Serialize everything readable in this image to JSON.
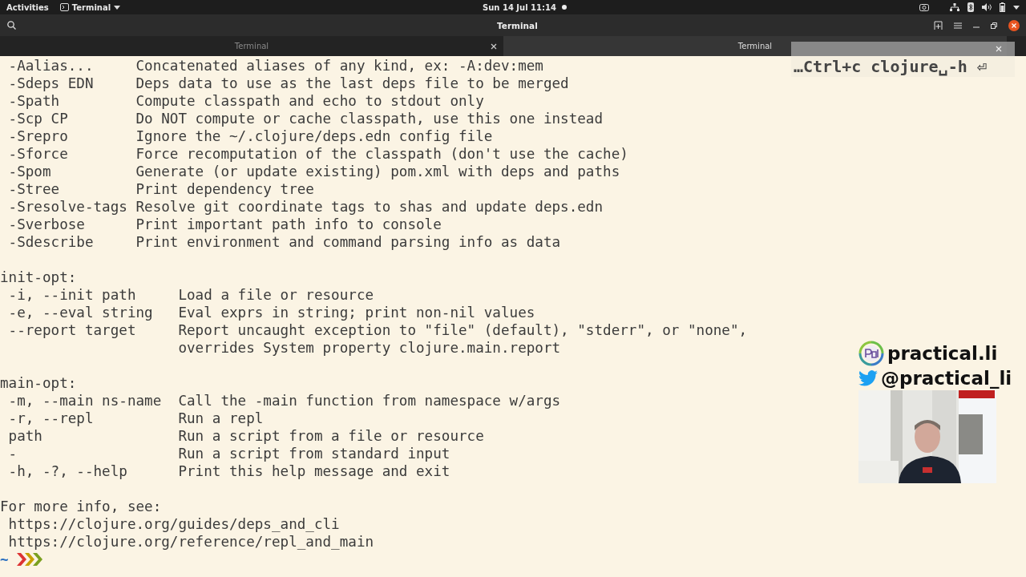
{
  "top_bar": {
    "activities": "Activities",
    "app_menu": "Terminal",
    "clock": "Sun 14 Jul  11:14"
  },
  "window": {
    "title": "Terminal"
  },
  "tabs": [
    {
      "label": "Terminal",
      "selected": false
    },
    {
      "label": "Terminal",
      "selected": true
    }
  ],
  "keystroke_overlay": {
    "text": "…Ctrl+c clojure␣-h ⏎"
  },
  "terminal_lines": [
    {
      "kind": "text",
      "text": " -Aalias...     Concatenated aliases of any kind, ex: -A:dev:mem"
    },
    {
      "kind": "text",
      "text": " -Sdeps EDN     Deps data to use as the last deps file to be merged"
    },
    {
      "kind": "text",
      "text": " -Spath         Compute classpath and echo to stdout only"
    },
    {
      "kind": "text",
      "text": " -Scp CP        Do NOT compute or cache classpath, use this one instead"
    },
    {
      "kind": "text",
      "text": " -Srepro        Ignore the ~/.clojure/deps.edn config file"
    },
    {
      "kind": "text",
      "text": " -Sforce        Force recomputation of the classpath (don't use the cache)"
    },
    {
      "kind": "text",
      "text": " -Spom          Generate (or update existing) pom.xml with deps and paths"
    },
    {
      "kind": "text",
      "text": " -Stree         Print dependency tree"
    },
    {
      "kind": "text",
      "text": " -Sresolve-tags Resolve git coordinate tags to shas and update deps.edn"
    },
    {
      "kind": "text",
      "text": " -Sverbose      Print important path info to console"
    },
    {
      "kind": "text",
      "text": " -Sdescribe     Print environment and command parsing info as data"
    },
    {
      "kind": "blank"
    },
    {
      "kind": "text",
      "text": "init-opt:"
    },
    {
      "kind": "text",
      "text": " -i, --init path     Load a file or resource"
    },
    {
      "kind": "text",
      "text": " -e, --eval string   Eval exprs in string; print non-nil values"
    },
    {
      "kind": "text",
      "text": " --report target     Report uncaught exception to \"file\" (default), \"stderr\", or \"none\","
    },
    {
      "kind": "text",
      "text": "                     overrides System property clojure.main.report"
    },
    {
      "kind": "blank"
    },
    {
      "kind": "text",
      "text": "main-opt:"
    },
    {
      "kind": "text",
      "text": " -m, --main ns-name  Call the -main function from namespace w/args"
    },
    {
      "kind": "text",
      "text": " -r, --repl          Run a repl"
    },
    {
      "kind": "text",
      "text": " path                Run a script from a file or resource"
    },
    {
      "kind": "text",
      "text": " -                   Run a script from standard input"
    },
    {
      "kind": "text",
      "text": " -h, -?, --help      Print this help message and exit"
    },
    {
      "kind": "blank"
    },
    {
      "kind": "text",
      "text": "For more info, see:"
    },
    {
      "kind": "text",
      "text": " https://clojure.org/guides/deps_and_cli"
    },
    {
      "kind": "text",
      "text": " https://clojure.org/reference/repl_and_main"
    }
  ],
  "prompt": {
    "cwd": "~"
  },
  "branding": {
    "site": "practical.li",
    "handle": "@practical_li"
  }
}
